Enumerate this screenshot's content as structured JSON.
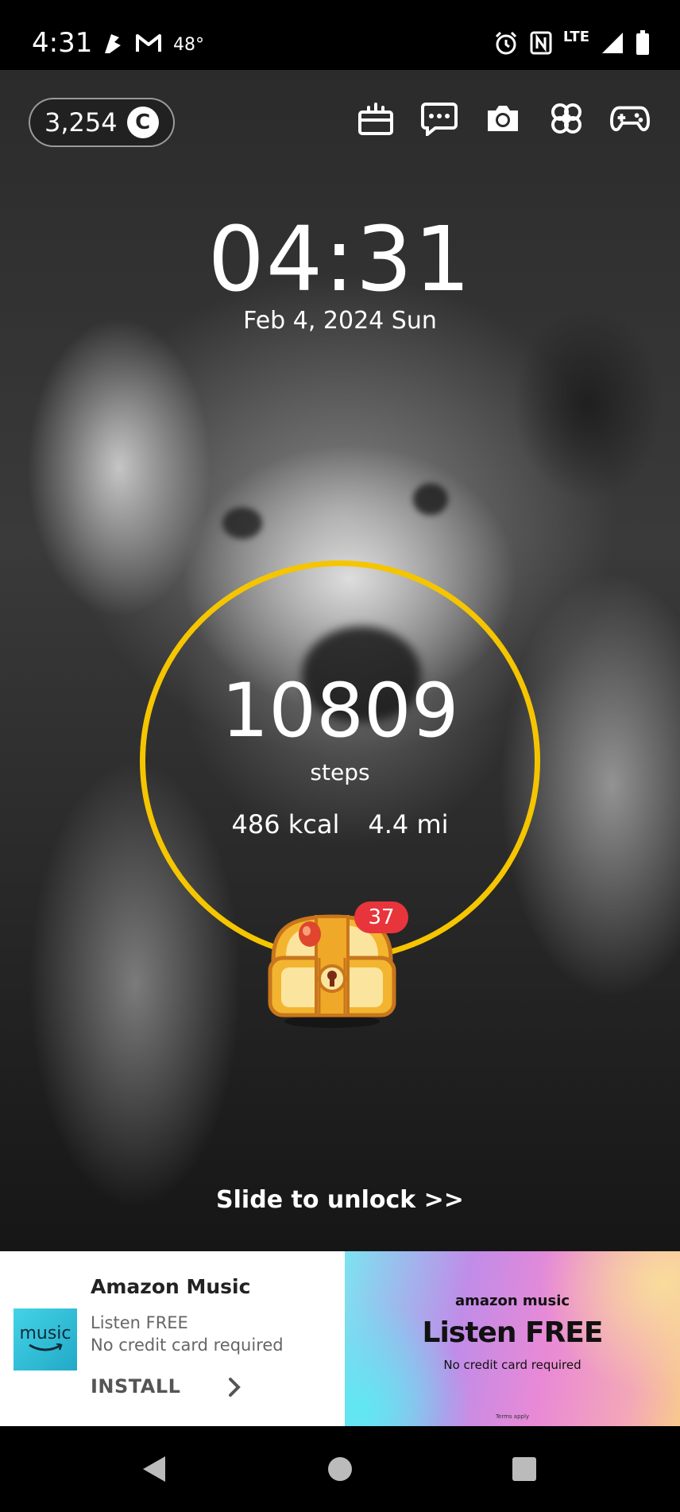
{
  "status_bar": {
    "time": "4:31",
    "temperature": "48°",
    "network": "LTE",
    "left_icons": [
      "fitness-icon",
      "gmail-icon"
    ],
    "right_icons": [
      "alarm-icon",
      "nfc-icon",
      "signal-icon",
      "battery-icon"
    ]
  },
  "header": {
    "coins": "3,254",
    "coin_symbol": "C",
    "actions": [
      "gift-icon",
      "chat-icon",
      "camera-icon",
      "clover-icon",
      "gamepad-icon"
    ]
  },
  "clock": {
    "time": "04:31",
    "date": "Feb 4, 2024 Sun"
  },
  "steps": {
    "count": "10809",
    "label": "steps",
    "calories": "486 kcal",
    "distance": "4.4 mi",
    "ring_color": "#f5c500"
  },
  "chest": {
    "badge": "37",
    "badge_color": "#e8353b"
  },
  "unlock_text": "Slide to unlock >>",
  "ad": {
    "logo_text": "music",
    "title": "Amazon Music",
    "line1": "Listen FREE",
    "line2": "No credit card required",
    "cta": "INSTALL",
    "banner_brand": "amazon music",
    "banner_headline": "Listen FREE",
    "banner_sub": "No credit card required",
    "banner_terms": "Terms apply"
  },
  "nav": {
    "buttons": [
      "back-icon",
      "home-icon",
      "recents-icon"
    ]
  }
}
